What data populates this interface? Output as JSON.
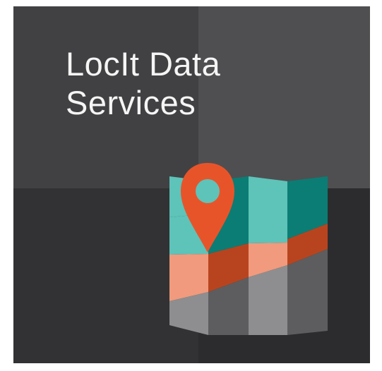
{
  "tile": {
    "title_line1": "LocIt Data",
    "title_line2": "Services",
    "icon": "map-pin-icon",
    "colors": {
      "background_dark": "#323234",
      "background_light": "#4f4f51",
      "text": "#f5f5f5",
      "pin": "#e8542a",
      "map_teal": "#5ec3b9",
      "map_teal_dark": "#0b7d74",
      "road_salmon": "#f19a7d",
      "road_rust": "#b8441f",
      "map_gray": "#8e8e90",
      "map_gray_dark": "#5d5d5f"
    }
  }
}
